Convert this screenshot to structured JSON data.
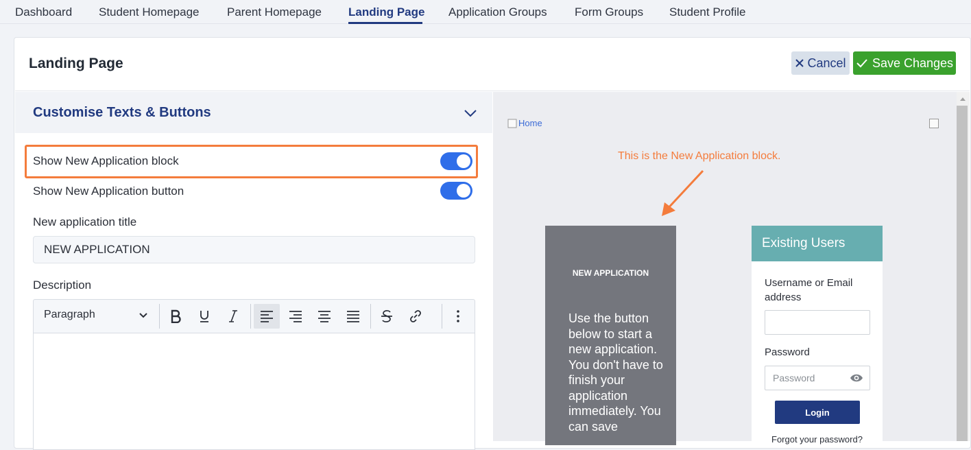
{
  "nav": {
    "tabs": [
      "Dashboard",
      "Student Homepage",
      "Parent Homepage",
      "Landing Page",
      "Application Groups",
      "Form Groups",
      "Student Profile"
    ],
    "active": "Landing Page"
  },
  "header": {
    "title": "Landing Page",
    "cancel_label": "Cancel",
    "save_label": "Save Changes"
  },
  "section": {
    "title": "Customise Texts & Buttons",
    "show_block_label": "Show New Application block",
    "show_block_on": true,
    "show_button_label": "Show New Application button",
    "show_button_on": true,
    "app_title_label": "New application title",
    "app_title_value": "NEW APPLICATION",
    "description_label": "Description",
    "editor": {
      "block_format": "Paragraph",
      "tools": [
        "bold-icon",
        "underline-icon",
        "italic-icon",
        "align-left-icon",
        "align-right-icon",
        "align-center-icon",
        "align-justify-icon",
        "strikethrough-icon",
        "link-icon",
        "more-vertical-icon"
      ]
    }
  },
  "preview": {
    "home_alt": "Home",
    "annotation": "This is the New Application block.",
    "new_app": {
      "title": "NEW APPLICATION",
      "description": "Use the button below to start a new application. You don't have to finish your application immediately. You can save"
    },
    "existing": {
      "title": "Existing Users",
      "username_label": "Username or Email address",
      "password_label": "Password",
      "password_placeholder": "Password",
      "login_label": "Login",
      "forgot_label": "Forgot your password?"
    }
  },
  "colors": {
    "brand_navy": "#213a80",
    "save_green": "#3aa12d",
    "toggle_blue": "#2f6ee9",
    "highlight_orange": "#f47c3c",
    "existing_teal": "#67aeb0",
    "new_app_grey": "#74767d"
  }
}
